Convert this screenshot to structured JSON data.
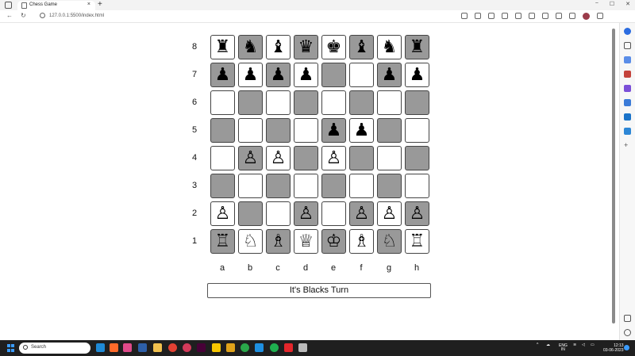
{
  "browser": {
    "tab_title": "Chess Game",
    "tab_close": "×",
    "new_tab": "+",
    "url": "127.0.0.1:5500/index.html",
    "back": "←",
    "reload": "↻",
    "window_controls": [
      "−",
      "☐",
      "✕"
    ]
  },
  "board": {
    "files": [
      "a",
      "b",
      "c",
      "d",
      "e",
      "f",
      "g",
      "h"
    ],
    "ranks": [
      "8",
      "7",
      "6",
      "5",
      "4",
      "3",
      "2",
      "1"
    ],
    "rows": [
      {
        "rank": "8",
        "cells": [
          {
            "shade": "light",
            "piece": "♜",
            "name": "black-rook"
          },
          {
            "shade": "dark",
            "piece": "♞",
            "name": "black-knight"
          },
          {
            "shade": "light",
            "piece": "♝",
            "name": "black-bishop"
          },
          {
            "shade": "dark",
            "piece": "♛",
            "name": "black-queen"
          },
          {
            "shade": "light",
            "piece": "♚",
            "name": "black-king"
          },
          {
            "shade": "dark",
            "piece": "♝",
            "name": "black-bishop"
          },
          {
            "shade": "light",
            "piece": "♞",
            "name": "black-knight"
          },
          {
            "shade": "dark",
            "piece": "♜",
            "name": "black-rook"
          }
        ]
      },
      {
        "rank": "7",
        "cells": [
          {
            "shade": "dark",
            "piece": "♟",
            "name": "black-pawn"
          },
          {
            "shade": "light",
            "piece": "♟",
            "name": "black-pawn"
          },
          {
            "shade": "dark",
            "piece": "♟",
            "name": "black-pawn"
          },
          {
            "shade": "light",
            "piece": "♟",
            "name": "black-pawn"
          },
          {
            "shade": "dark",
            "piece": "",
            "name": "empty"
          },
          {
            "shade": "light",
            "piece": "",
            "name": "empty"
          },
          {
            "shade": "dark",
            "piece": "♟",
            "name": "black-pawn"
          },
          {
            "shade": "light",
            "piece": "♟",
            "name": "black-pawn"
          }
        ]
      },
      {
        "rank": "6",
        "cells": [
          {
            "shade": "light",
            "piece": "",
            "name": "empty"
          },
          {
            "shade": "dark",
            "piece": "",
            "name": "empty"
          },
          {
            "shade": "light",
            "piece": "",
            "name": "empty"
          },
          {
            "shade": "dark",
            "piece": "",
            "name": "empty"
          },
          {
            "shade": "light",
            "piece": "",
            "name": "empty"
          },
          {
            "shade": "dark",
            "piece": "",
            "name": "empty"
          },
          {
            "shade": "light",
            "piece": "",
            "name": "empty"
          },
          {
            "shade": "dark",
            "piece": "",
            "name": "empty"
          }
        ]
      },
      {
        "rank": "5",
        "cells": [
          {
            "shade": "dark",
            "piece": "",
            "name": "empty"
          },
          {
            "shade": "light",
            "piece": "",
            "name": "empty"
          },
          {
            "shade": "dark",
            "piece": "",
            "name": "empty"
          },
          {
            "shade": "light",
            "piece": "",
            "name": "empty"
          },
          {
            "shade": "dark",
            "piece": "♟",
            "name": "black-pawn"
          },
          {
            "shade": "light",
            "piece": "♟",
            "name": "black-pawn"
          },
          {
            "shade": "dark",
            "piece": "",
            "name": "empty"
          },
          {
            "shade": "light",
            "piece": "",
            "name": "empty"
          }
        ]
      },
      {
        "rank": "4",
        "cells": [
          {
            "shade": "light",
            "piece": "",
            "name": "empty"
          },
          {
            "shade": "dark",
            "piece": "♙",
            "name": "white-pawn"
          },
          {
            "shade": "light",
            "piece": "♙",
            "name": "white-pawn"
          },
          {
            "shade": "dark",
            "piece": "",
            "name": "empty"
          },
          {
            "shade": "light",
            "piece": "♙",
            "name": "white-pawn"
          },
          {
            "shade": "dark",
            "piece": "",
            "name": "empty"
          },
          {
            "shade": "light",
            "piece": "",
            "name": "empty"
          },
          {
            "shade": "dark",
            "piece": "",
            "name": "empty"
          }
        ]
      },
      {
        "rank": "3",
        "cells": [
          {
            "shade": "dark",
            "piece": "",
            "name": "empty"
          },
          {
            "shade": "light",
            "piece": "",
            "name": "empty"
          },
          {
            "shade": "dark",
            "piece": "",
            "name": "empty"
          },
          {
            "shade": "light",
            "piece": "",
            "name": "empty"
          },
          {
            "shade": "dark",
            "piece": "",
            "name": "empty"
          },
          {
            "shade": "light",
            "piece": "",
            "name": "empty"
          },
          {
            "shade": "dark",
            "piece": "",
            "name": "empty"
          },
          {
            "shade": "light",
            "piece": "",
            "name": "empty"
          }
        ]
      },
      {
        "rank": "2",
        "cells": [
          {
            "shade": "light",
            "piece": "♙",
            "name": "white-pawn"
          },
          {
            "shade": "dark",
            "piece": "",
            "name": "empty"
          },
          {
            "shade": "light",
            "piece": "",
            "name": "empty"
          },
          {
            "shade": "dark",
            "piece": "♙",
            "name": "white-pawn"
          },
          {
            "shade": "light",
            "piece": "",
            "name": "empty"
          },
          {
            "shade": "dark",
            "piece": "♙",
            "name": "white-pawn"
          },
          {
            "shade": "light",
            "piece": "♙",
            "name": "white-pawn"
          },
          {
            "shade": "dark",
            "piece": "♙",
            "name": "white-pawn"
          }
        ]
      },
      {
        "rank": "1",
        "cells": [
          {
            "shade": "dark",
            "piece": "♖",
            "name": "white-rook"
          },
          {
            "shade": "light",
            "piece": "♘",
            "name": "white-knight"
          },
          {
            "shade": "dark",
            "piece": "♗",
            "name": "white-bishop"
          },
          {
            "shade": "light",
            "piece": "♕",
            "name": "white-queen"
          },
          {
            "shade": "dark",
            "piece": "♔",
            "name": "white-king"
          },
          {
            "shade": "light",
            "piece": "♗",
            "name": "white-bishop"
          },
          {
            "shade": "dark",
            "piece": "♘",
            "name": "white-knight"
          },
          {
            "shade": "light",
            "piece": "♖",
            "name": "white-rook"
          }
        ]
      }
    ]
  },
  "status": {
    "turn_text": "It's Blacks Turn"
  },
  "taskbar": {
    "search_placeholder": "Search",
    "language": "ENG",
    "region": "IN",
    "time": "12:13",
    "date": "03-06-2023"
  },
  "colors": {
    "dark_square": "#999999",
    "light_square": "#ffffff",
    "taskbar": "#1f1f1f",
    "accent": "#3b9cff"
  }
}
